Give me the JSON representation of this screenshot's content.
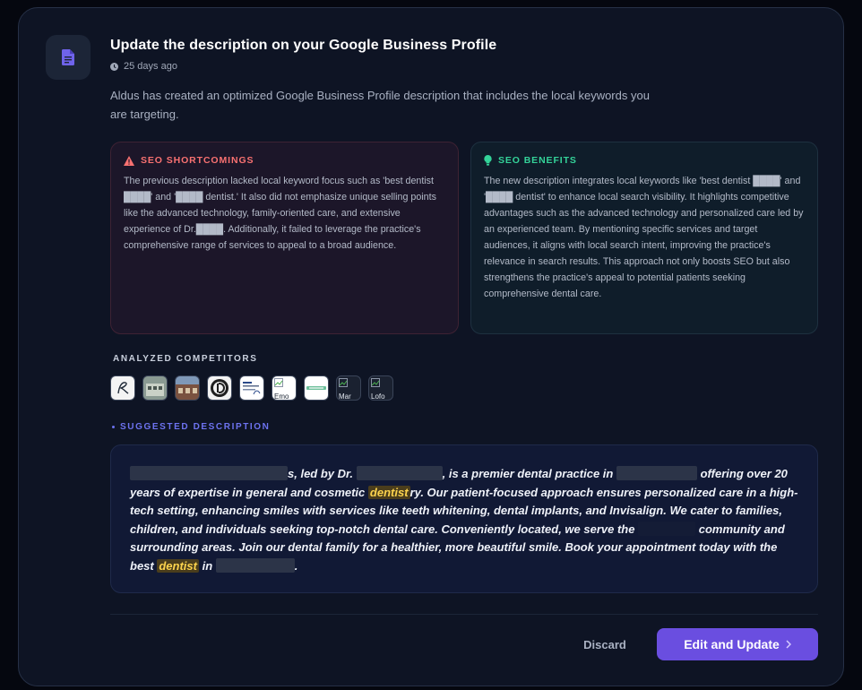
{
  "task": {
    "title": "Update the description on your Google Business Profile",
    "time_ago": "25 days ago",
    "intro": "Aldus has created an optimized Google Business Profile description that includes the local keywords you are targeting."
  },
  "shortcomings": {
    "heading": "SEO SHORTCOMINGS",
    "text": "The previous description lacked local keyword focus such as 'best dentist ████' and '████ dentist.' It also did not emphasize unique selling points like the advanced technology, family-oriented care, and extensive experience of Dr.████. Additionally, it failed to leverage the practice's comprehensive range of services to appeal to a broad audience."
  },
  "benefits": {
    "heading": "SEO BENEFITS",
    "text": "The new description integrates local keywords like 'best dentist ████' and '████ dentist' to enhance local search visibility. It highlights competitive advantages such as the advanced technology and personalized care led by an experienced team. By mentioning specific services and target audiences, it aligns with local search intent, improving the practice's relevance in search results. This approach not only boosts SEO but also strengthens the practice's appeal to potential patients seeking comprehensive dental care."
  },
  "competitors": {
    "label": "ANALYZED COMPETITORS",
    "items": [
      {
        "alt": ""
      },
      {
        "alt": ""
      },
      {
        "alt": ""
      },
      {
        "alt": ""
      },
      {
        "alt": ""
      },
      {
        "alt": "Emo"
      },
      {
        "alt": ""
      },
      {
        "alt": "Mar"
      },
      {
        "alt": "Lofo"
      }
    ]
  },
  "suggested": {
    "label": "SUGGESTED DESCRIPTION",
    "parts": [
      "s, led by Dr.",
      ", is a premier dental practice in",
      "offering over 20 years of expertise in general and cosmetic",
      "dentist",
      "ry. Our patient-focused approach ensures personalized care in a high-tech setting, enhancing smiles with services like teeth whitening, dental implants, and Invisalign. We cater to families, children, and individuals seeking top-notch dental care. Conveniently located, we serve the",
      "community and surrounding areas. Join our dental family for a healthier, more beautiful smile. Book your appointment today with the best",
      "dentist",
      "in",
      "."
    ]
  },
  "actions": {
    "discard": "Discard",
    "edit": "Edit and Update"
  },
  "colors": {
    "accent": "#6a4ee0",
    "shortcoming": "#f87171",
    "benefit": "#34d399",
    "highlight": "#fcd34d"
  }
}
